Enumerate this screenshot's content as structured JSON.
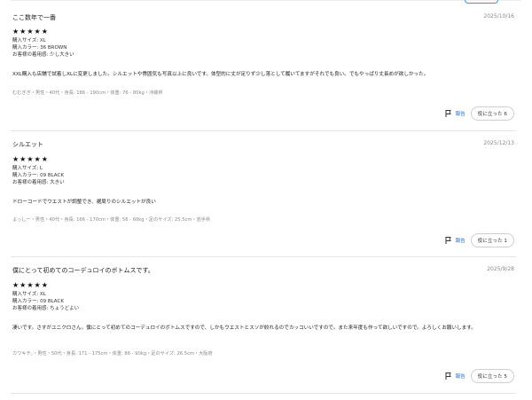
{
  "reviews": [
    {
      "title": "ここ数年で一番",
      "date": "2025/10/16",
      "stars": "★★★★★",
      "size": "購入サイズ: XL",
      "color": "購入カラー: 36 BROWN",
      "fit": "お客様の着用感: 少し大きい",
      "body": "XXL購入も店舗で試着しXLに変更しました。シルエットや雰囲気も写真以上に良いです。体型的に丈が足りず少し落として履いてますがそれでも良い。でもやっぱり丈長めが欲しかった。",
      "profile": "むむぎぎ・男性・40代・身長: 186 - 190cm・体重: 76 - 80kg・沖縄県",
      "report_label": "報告",
      "helpful_label": "役に立った 6"
    },
    {
      "title": "シルエット",
      "date": "2025/12/13",
      "stars": "★★★★★",
      "size": "購入サイズ: L",
      "color": "購入カラー: 09 BLACK",
      "fit": "お客様の着用感: 大きい",
      "body": "ドローコードでウエストが調整でき、裾周りのシルエットが良い",
      "profile": "よっしー・男性・40代・身長: 166 - 170cm・体重: 56 - 60kg・足のサイズ: 25.5cm・岩手県",
      "report_label": "報告",
      "helpful_label": "役に立った 1"
    },
    {
      "title": "僕にとって初めてのコーデュロイのボトムスです。",
      "date": "2025/9/28",
      "stars": "★★★★★",
      "size": "購入サイズ: XL",
      "color": "購入カラー: 09 BLACK",
      "fit": "お客様の着用感: ちょうどよい",
      "body": "凄いです。さすがユニクロさん。僕にとって初めてのコーデュロイのボトムスですので、しかもウエストとスソが絞れるのでカッコいいですので。また来年度も作って欲しいですので。よろしくお願いします。",
      "profile": "カワキチ。・男性・50代・身長: 171 - 175cm・体重: 86 - 90kg・足のサイズ: 26.5cm・大阪府",
      "report_label": "報告",
      "helpful_label": "役に立った 5"
    }
  ]
}
